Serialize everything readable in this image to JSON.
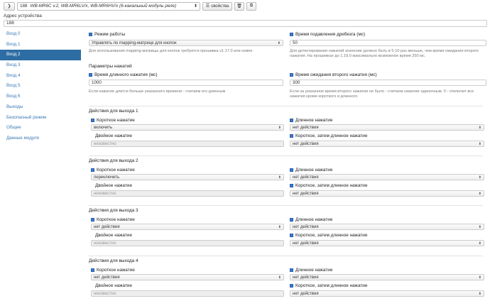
{
  "topbar": {
    "address": "188",
    "device": "WB-MR6C v.2, WB-MR6LV/x, WB-MR6HV/x (6-канальный модуль реле)",
    "properties_label": "свойства"
  },
  "address": {
    "label": "Адрес устройства",
    "value": "188"
  },
  "sidebar": {
    "items": [
      "Вход 0",
      "Вход 1",
      "Вход 2",
      "Вход 3",
      "Вход 4",
      "Вход 5",
      "Вход 6",
      "Выходы",
      "Безопасный режим",
      "Общее",
      "Данные модуля"
    ],
    "active_index": 2
  },
  "settings": {
    "mode_label": "Режим работы",
    "mode_value": "Управлять по mapping-матрице для кнопок",
    "mode_help": "Для использования mapping-матрицы для кнопок требуется прошивка v1.17.0 или новее",
    "debounce_label": "Время подавления дребезга (мс)",
    "debounce_value": "50",
    "debounce_help": "Для детектирования нажатий значение должно быть в 5-10 раз меньше, чем время ожидания второго нажатия. На прошивках до 1.19.0 максимально возможное время 250 мс.",
    "press_params_title": "Параметры нажатий",
    "long_press_label": "Время длинного нажатия (мс)",
    "long_press_value": "1000",
    "long_press_help": "Если нажатие длится больше указанного времени - считаем его длинным",
    "second_press_label": "Время ожидания второго нажатия (мс)",
    "second_press_value": "300",
    "second_press_help": "Если за указанное время второго нажатия не было - считаем нажатие одиночным. 0 - отключит все нажатия кроме короткого и длинного"
  },
  "labels": {
    "short": "Короткое нажатие",
    "long": "Длинное нажатие",
    "double": "Двойное нажатие",
    "short_then_long": "Короткое, затем длинное нажатие"
  },
  "outputs": [
    {
      "title": "Действия для выхода 1",
      "short": "включить",
      "long": "нет действия",
      "double": "неизвестно",
      "short_then_long": "нет действия"
    },
    {
      "title": "Действия для выхода 2",
      "short": "переключить",
      "long": "нет действия",
      "double": "неизвестно",
      "short_then_long": "нет действия"
    },
    {
      "title": "Действия для выхода 3",
      "short": "нет действия",
      "long": "нет действия",
      "double": "неизвестно",
      "short_then_long": "нет действия"
    },
    {
      "title": "Действия для выхода 4",
      "short": "нет действия",
      "long": "нет действия",
      "double": "неизвестно",
      "short_then_long": "нет действия"
    }
  ]
}
